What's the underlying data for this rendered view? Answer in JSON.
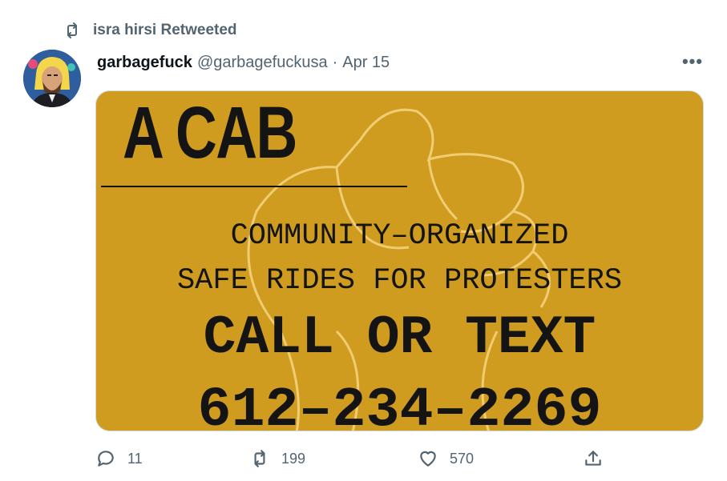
{
  "retweet": {
    "icon": "retweet-icon",
    "label": "isra hirsi Retweeted"
  },
  "tweet": {
    "name": "garbagefuck",
    "handle": "@garbagefuckusa",
    "separator": "·",
    "date": "Apr 15",
    "more_icon": "more-icon"
  },
  "card": {
    "title": "A CAB",
    "line1": "COMMUNITY–ORGANIZED",
    "line2": "SAFE RIDES FOR PROTESTERS",
    "line3": "CALL OR TEXT",
    "line4": "612–234–2269",
    "background_color": "#cf9c1f"
  },
  "actions": {
    "reply": {
      "icon": "reply-icon",
      "count": "11"
    },
    "retweet": {
      "icon": "retweet-icon",
      "count": "199"
    },
    "like": {
      "icon": "heart-icon",
      "count": "570"
    },
    "share": {
      "icon": "share-icon"
    }
  }
}
